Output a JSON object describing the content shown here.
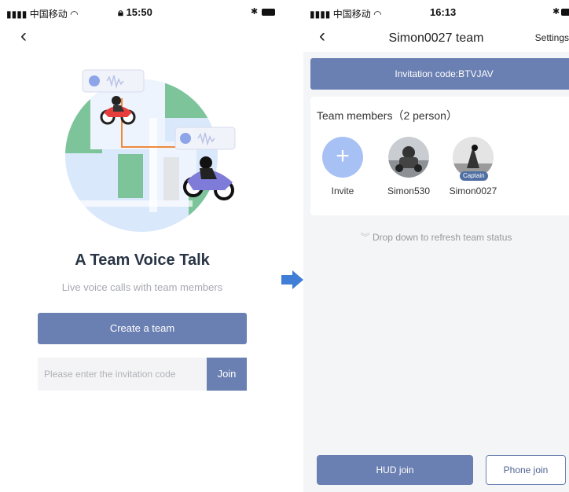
{
  "left_screen": {
    "status_bar": {
      "carrier": "中国移动",
      "time": "15:50"
    },
    "headline": "A Team Voice Talk",
    "subline": "Live voice calls with team members",
    "create_button": "Create a team",
    "invitation_input": {
      "placeholder": "Please enter the invitation code",
      "value": ""
    },
    "join_button": "Join"
  },
  "right_screen": {
    "status_bar": {
      "carrier": "中国移动",
      "time": "16:13"
    },
    "nav": {
      "title": "Simon0027 team",
      "settings": "Settings"
    },
    "invitation_code": "Invitation code:BTVJAV",
    "members_title": "Team members（2 person）",
    "members": [
      {
        "name": "Invite"
      },
      {
        "name": "Simon530"
      },
      {
        "name": "Simon0027",
        "badge": "Captain"
      }
    ],
    "refresh_hint": "Drop down to refresh team status",
    "hud_button": "HUD join",
    "phone_button": "Phone join"
  },
  "colors": {
    "accent": "#6a7fb2",
    "invite_circle": "#a7c1f5",
    "page_bg": "#f4f5f7",
    "arrow": "#3f7dd6"
  },
  "icons": [
    "signal-icon",
    "wifi-icon",
    "lock-icon",
    "bluetooth-icon",
    "battery-icon",
    "back-icon",
    "plus-icon",
    "chevron-down-icon",
    "arrow-right-icon"
  ]
}
